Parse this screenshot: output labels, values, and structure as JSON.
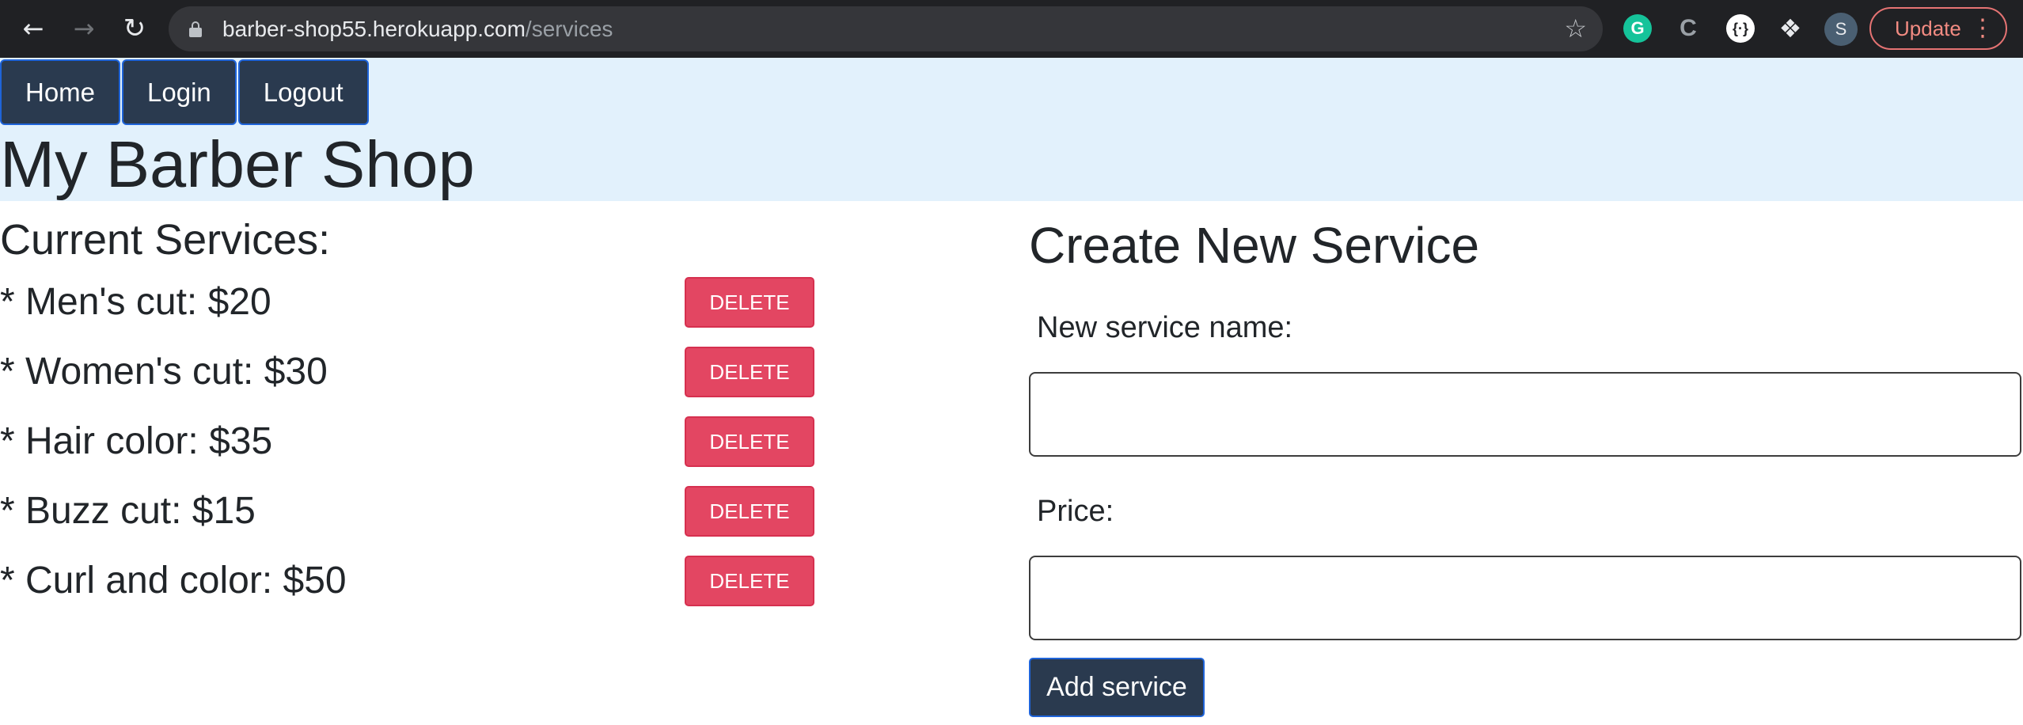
{
  "browser": {
    "url_host": "barber-shop55.herokuapp.com",
    "url_path": "/services",
    "back_icon": "arrow-left-icon",
    "forward_icon": "arrow-right-icon",
    "reload_icon": "reload-icon",
    "bookmark_icon": "star-icon",
    "extensions": {
      "grammarly": "G",
      "c_ext": "C",
      "other": "{·}"
    },
    "profile_initial": "S",
    "update_label": "Update"
  },
  "nav": {
    "links": [
      {
        "label": "Home"
      },
      {
        "label": "Login"
      },
      {
        "label": "Logout"
      }
    ]
  },
  "site": {
    "title": "My Barber Shop"
  },
  "services": {
    "heading": "Current Services:",
    "items": [
      {
        "text": "* Men's cut: $20",
        "name": "Men's cut",
        "price": 20
      },
      {
        "text": "* Women's cut: $30",
        "name": "Women's cut",
        "price": 30
      },
      {
        "text": "* Hair color: $35",
        "name": "Hair color",
        "price": 35
      },
      {
        "text": "* Buzz cut: $15",
        "name": "Buzz cut",
        "price": 15
      },
      {
        "text": "* Curl and color: $50",
        "name": "Curl and color",
        "price": 50
      }
    ],
    "delete_label": "DELETE"
  },
  "create": {
    "heading": "Create New Service",
    "name_label": "New service name:",
    "name_value": "",
    "price_label": "Price:",
    "price_value": "",
    "submit_label": "Add service"
  },
  "colors": {
    "header_bg": "#e2f1fc",
    "nav_button_bg": "#2a3a4f",
    "nav_button_border": "#1f64d9",
    "delete_bg": "#e34662",
    "text": "#212529"
  }
}
